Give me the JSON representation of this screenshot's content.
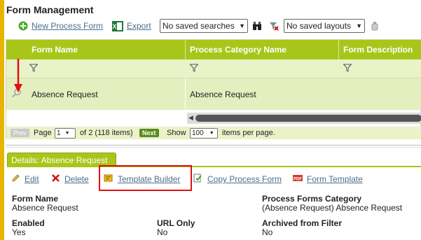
{
  "page": {
    "title": "Form Management"
  },
  "toolbar": {
    "new_label": "New Process Form",
    "export_label": "Export",
    "saved_searches": "No saved searches",
    "saved_layouts": "No saved layouts"
  },
  "grid": {
    "columns": [
      "Form Name",
      "Process Category Name",
      "Form Description"
    ],
    "rows": [
      {
        "form_name": "Absence Request",
        "category": "Absence Request"
      }
    ]
  },
  "pager": {
    "prev": "Prev",
    "page_label": "Page",
    "page_value": "1",
    "of_text": "of 2 (118 items)",
    "next": "Next",
    "show_label": "Show",
    "show_value": "100",
    "per_page": "items per page."
  },
  "details": {
    "tab_label": "Details: Absence Request",
    "actions": {
      "edit": "Edit",
      "delete": "Delete",
      "template_builder": "Template Builder",
      "copy": "Copy Process Form",
      "form_template": "Form Template"
    },
    "fields": {
      "form_name_label": "Form Name",
      "form_name_value": "Absence Request",
      "category_label": "Process Forms Category",
      "category_value": "(Absence Request) Absence Request",
      "enabled_label": "Enabled",
      "enabled_value": "Yes",
      "url_only_label": "URL Only",
      "url_only_value": "No",
      "archived_label": "Archived from Filter",
      "archived_value": "No"
    }
  },
  "colors": {
    "accent": "#a8c61a",
    "highlight": "#e01010",
    "left_bar": "#e8b400"
  }
}
